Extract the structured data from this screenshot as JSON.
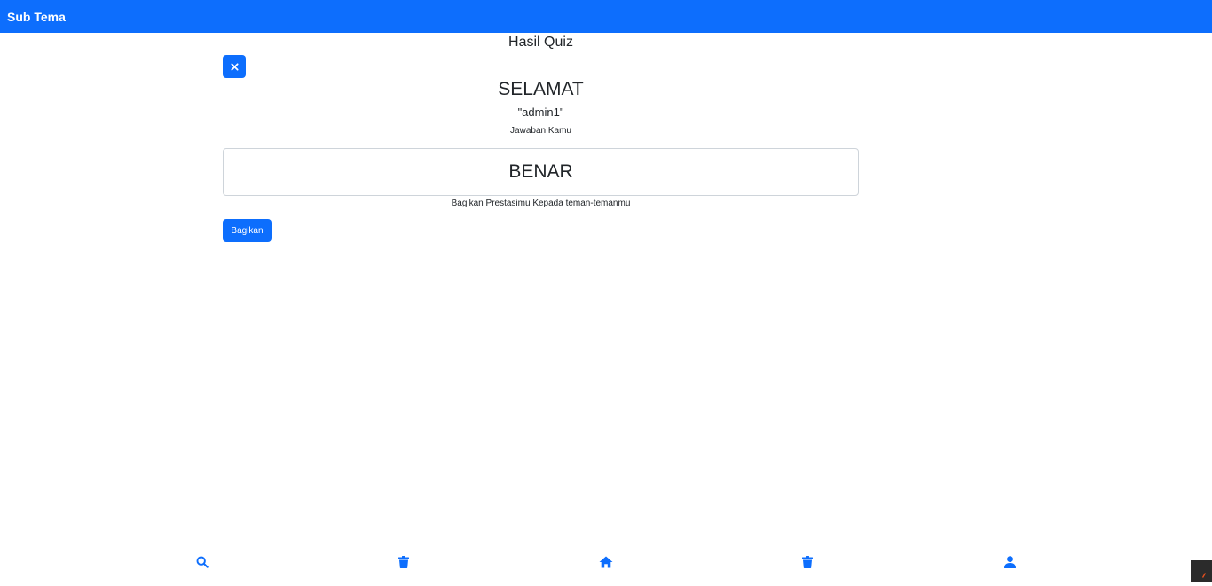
{
  "header": {
    "title": "Sub Tema"
  },
  "quiz_result": {
    "page_title": "Hasil Quiz",
    "congrats": "SELAMAT",
    "username": "\"admin1\"",
    "answer_label": "Jawaban Kamu",
    "result": "BENAR",
    "share_text": "Bagikan Prestasimu Kepada teman-temanmu",
    "share_button": "Bagikan"
  },
  "bottom_nav": {
    "items": [
      {
        "icon": "search-icon"
      },
      {
        "icon": "trash-icon"
      },
      {
        "icon": "home-icon"
      },
      {
        "icon": "trash-icon"
      },
      {
        "icon": "user-icon"
      }
    ]
  },
  "colors": {
    "primary": "#0d6efd",
    "text": "#212529",
    "border": "#ced4da"
  }
}
